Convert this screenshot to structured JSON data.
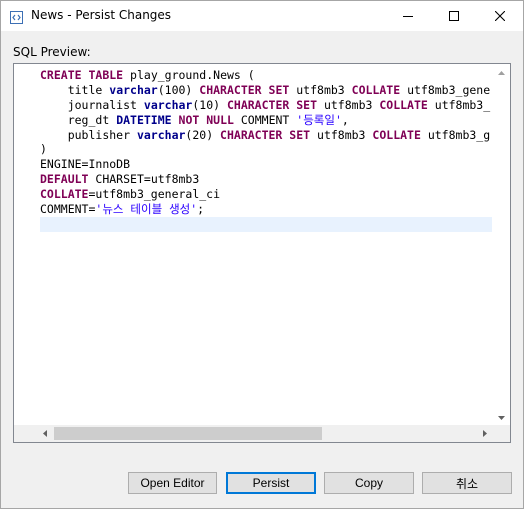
{
  "window": {
    "title": "News - Persist Changes",
    "controls": {
      "minimize": "minimize",
      "maximize": "maximize",
      "close": "close"
    }
  },
  "preview": {
    "label": "SQL Preview:",
    "lines": [
      "CREATE TABLE play_ground.News (",
      "    title varchar(100) CHARACTER SET utf8mb3 COLLATE utf8mb3_gene",
      "    journalist varchar(10) CHARACTER SET utf8mb3 COLLATE utf8mb3_",
      "    reg_dt DATETIME NOT NULL COMMENT '등록일',",
      "    publisher varchar(20) CHARACTER SET utf8mb3 COLLATE utf8mb3_g",
      ")",
      "ENGINE=InnoDB",
      "DEFAULT CHARSET=utf8mb3",
      "COLLATE=utf8mb3_general_ci",
      "COMMENT='뉴스 테이블 생성';",
      ""
    ]
  },
  "buttons": {
    "open_editor": "Open Editor",
    "persist": "Persist",
    "copy": "Copy",
    "cancel": "취소"
  },
  "colors": {
    "keyword": "#7f0055",
    "type": "#00008b",
    "string": "#2a00ff",
    "current_line": "#e8f2fe",
    "default_button_border": "#0078d7"
  }
}
